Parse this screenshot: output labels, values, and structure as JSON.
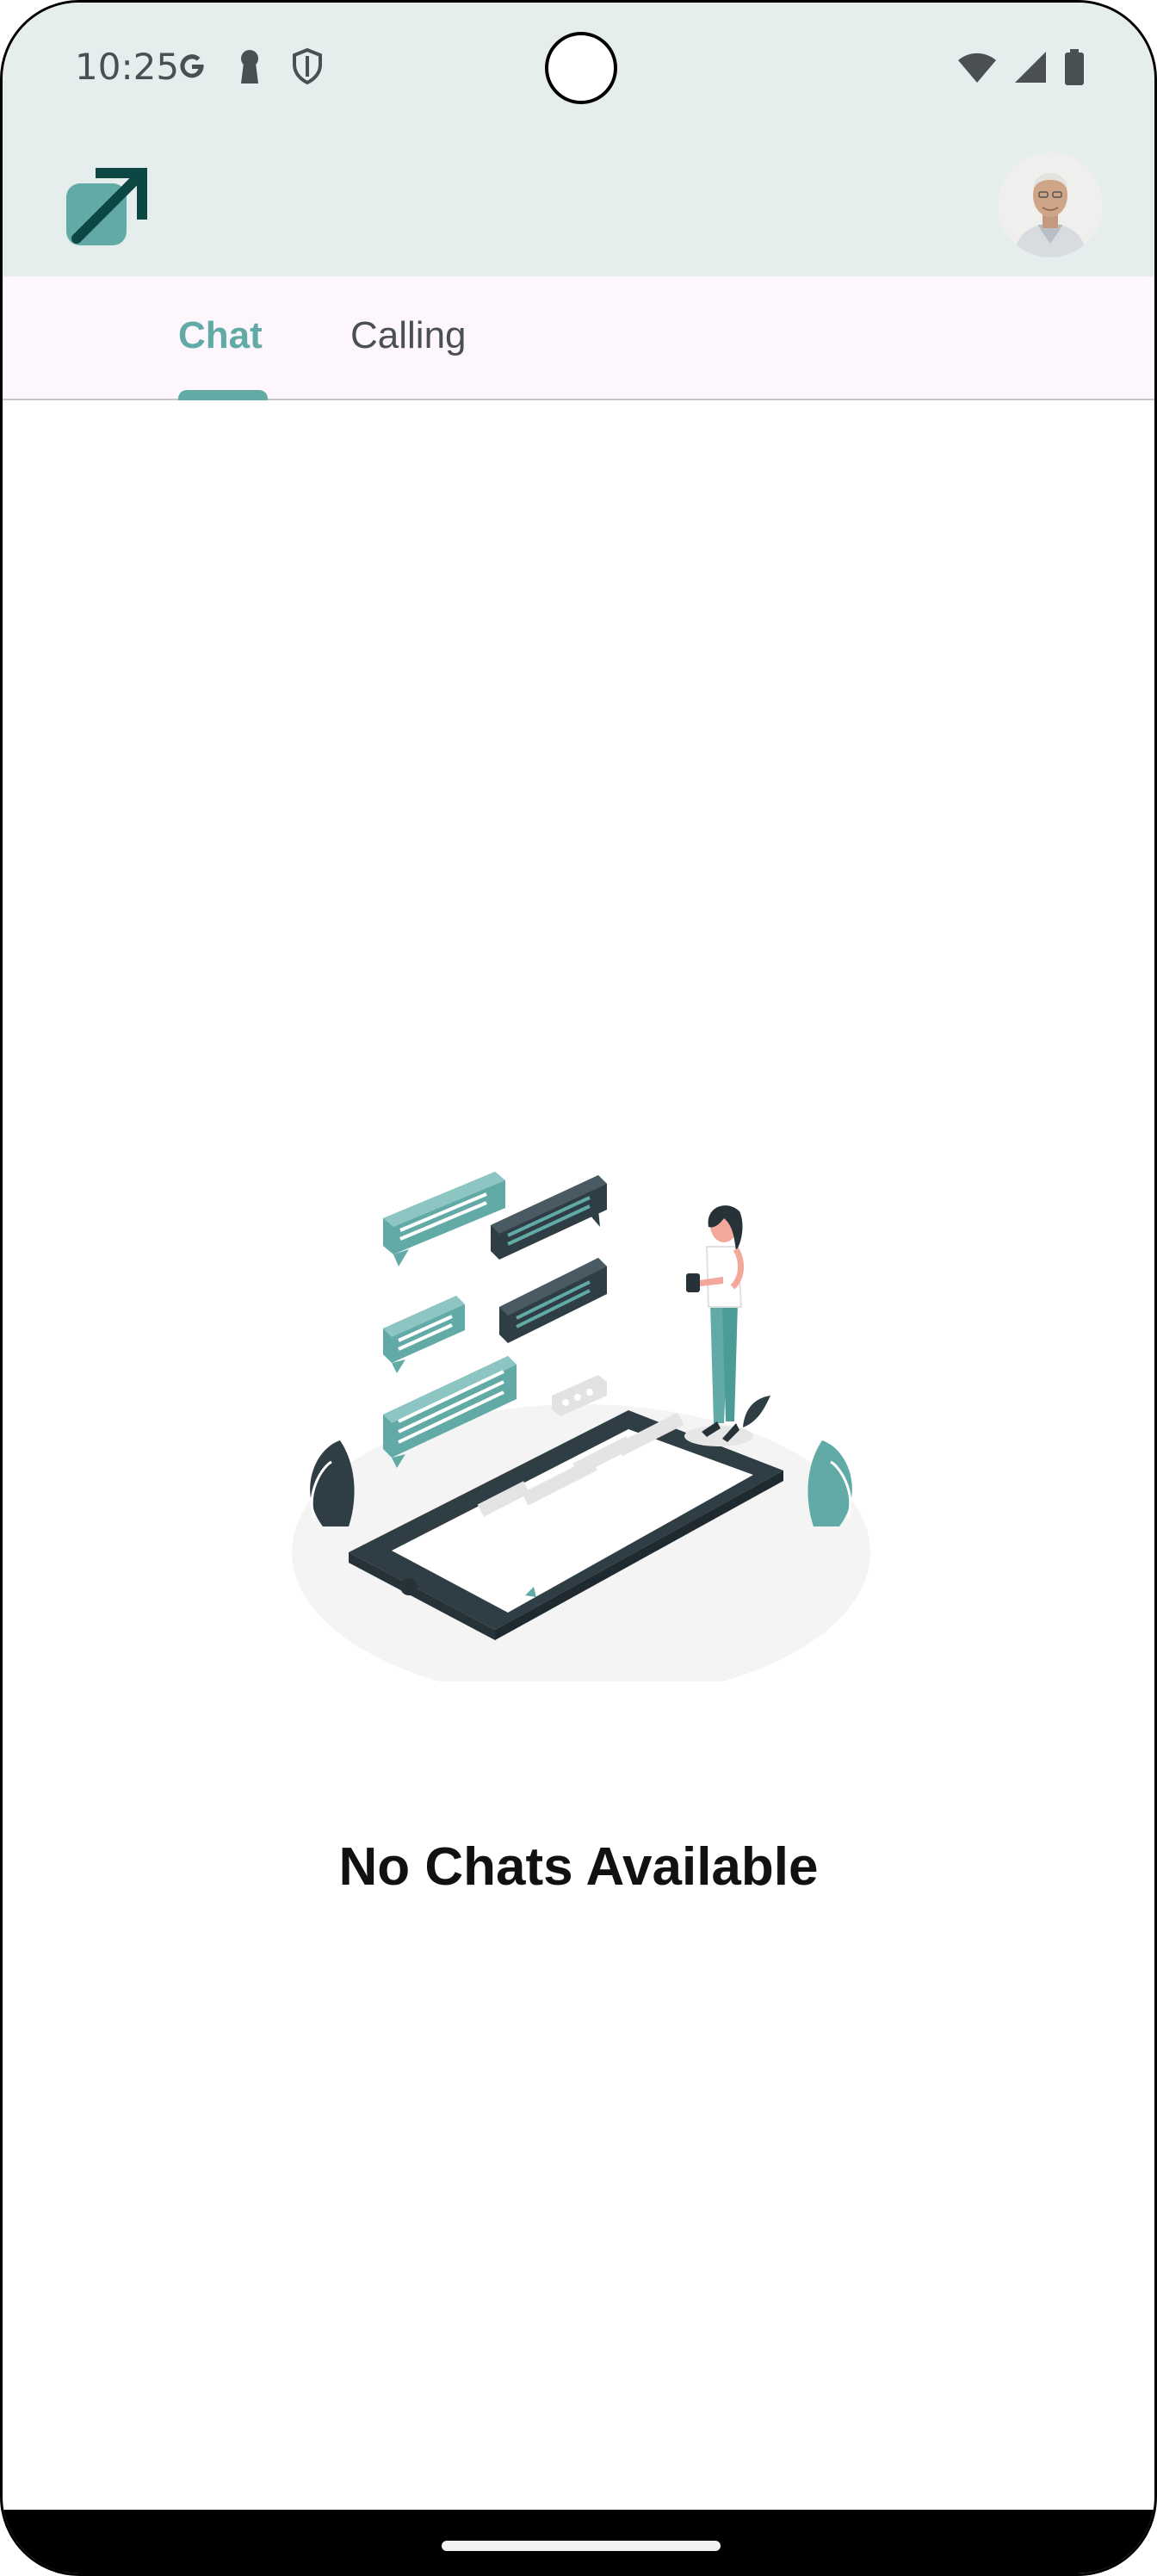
{
  "status_bar": {
    "time": "10:25",
    "left_icons": [
      "google-icon",
      "keyhole-icon",
      "shield-icon"
    ],
    "right_icons": [
      "wifi-icon",
      "cell-signal-icon",
      "battery-icon"
    ]
  },
  "app_bar": {
    "logo_icon": "arrow-up-right-logo-icon",
    "avatar": "user-avatar"
  },
  "tabs": [
    {
      "label": "Chat",
      "selected": true
    },
    {
      "label": "Calling",
      "selected": false
    }
  ],
  "empty_state": {
    "illustration": "chat-messages-illustration",
    "message": "No Chats Available"
  },
  "colors": {
    "accent": "#61aaa6",
    "accent_dark": "#2f3d44",
    "appbar_bg": "#e6eeed",
    "tabs_bg": "#fdf6fd"
  }
}
